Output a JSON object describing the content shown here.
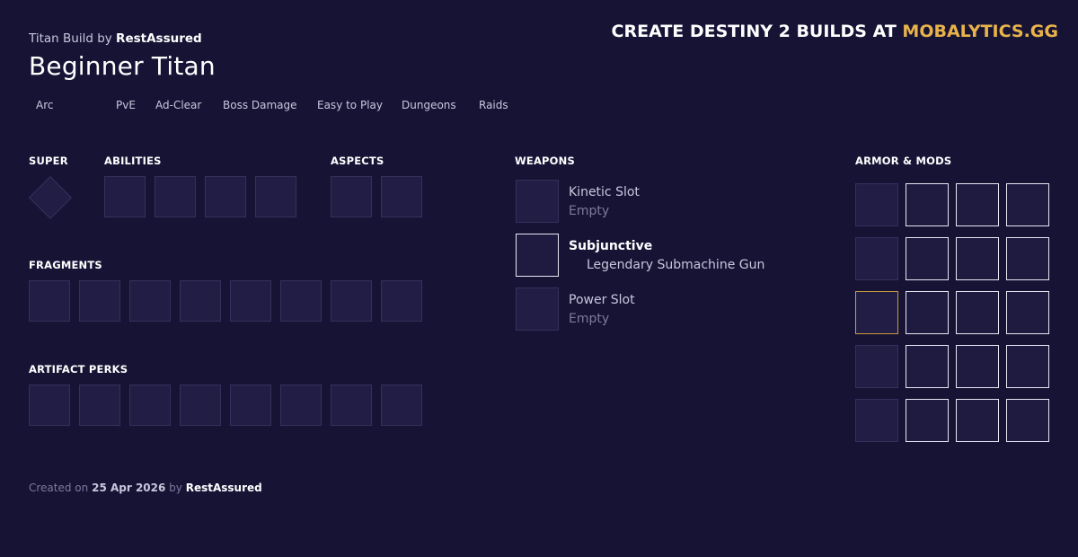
{
  "header": {
    "subtitle_prefix": "Titan Build",
    "subtitle_by": "by",
    "author": "RestAssured",
    "title": "Beginner Titan"
  },
  "promo": {
    "text": "CREATE DESTINY 2 BUILDS AT",
    "brand": "MOBALYTICS.GG"
  },
  "tags": [
    "Arc",
    "PvE",
    "Ad-Clear",
    "Boss Damage",
    "Easy to Play",
    "Dungeons",
    "Raids"
  ],
  "sections": {
    "super": "SUPER",
    "abilities": "ABILITIES",
    "aspects": "ASPECTS",
    "fragments": "FRAGMENTS",
    "artifact_perks": "ARTIFACT PERKS",
    "weapons": "WEAPONS",
    "armor_mods": "ARMOR & MODS"
  },
  "weapons": [
    {
      "name": "Kinetic Slot",
      "detail": "Empty"
    },
    {
      "name": "Subjunctive",
      "detail": "Legendary Submachine Gun"
    },
    {
      "name": "Power Slot",
      "detail": "Empty"
    }
  ],
  "footer": {
    "created_on": "Created on",
    "date": "25 Apr 2026",
    "by": "by",
    "author": "RestAssured"
  }
}
